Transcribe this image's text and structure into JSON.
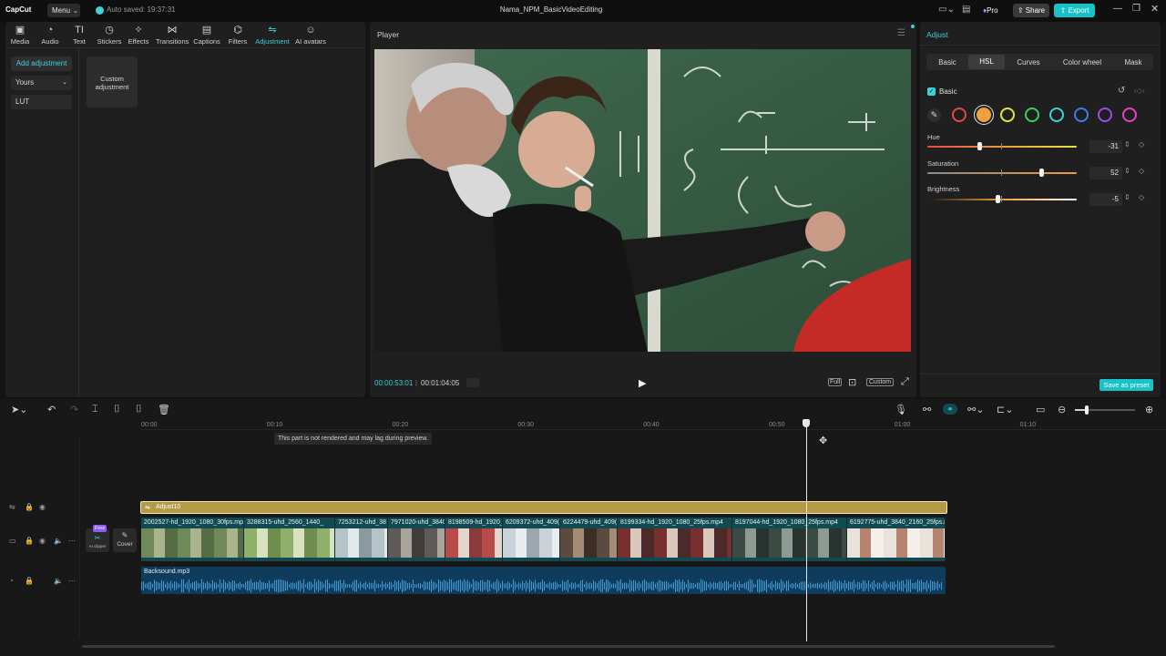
{
  "app": {
    "logo": "CapCut",
    "menu_label": "Menu",
    "autosave": "Auto saved: 19:37:31",
    "project_title": "Nama_NPM_BasicVideoEditing",
    "pro_label": "Pro",
    "share_label": "Share",
    "export_label": "Export"
  },
  "toolbar": {
    "items": [
      {
        "label": "Media",
        "icon": "media-icon"
      },
      {
        "label": "Audio",
        "icon": "audio-icon"
      },
      {
        "label": "Text",
        "icon": "text-icon"
      },
      {
        "label": "Stickers",
        "icon": "stickers-icon"
      },
      {
        "label": "Effects",
        "icon": "effects-icon"
      },
      {
        "label": "Transitions",
        "icon": "transitions-icon"
      },
      {
        "label": "Captions",
        "icon": "captions-icon"
      },
      {
        "label": "Filters",
        "icon": "filters-icon"
      },
      {
        "label": "Adjustment",
        "icon": "adjustment-icon",
        "active": true
      },
      {
        "label": "AI avatars",
        "icon": "ai-avatars-icon"
      }
    ]
  },
  "left": {
    "add_adjustment": "Add adjustment",
    "yours": "Yours",
    "lut": "LUT",
    "custom_card": "Custom adjustment"
  },
  "player": {
    "title": "Player",
    "current_time": "00:00:53:01",
    "total_time": "00:01:04:05",
    "full_label": "Full",
    "custom_label": "Custom"
  },
  "adjust": {
    "title": "Adjust",
    "tabs": [
      "Basic",
      "HSL",
      "Curves",
      "Color wheel",
      "Mask"
    ],
    "active_tab": "HSL",
    "section": "Basic",
    "swatch_colors": [
      "#e8444a",
      "#f0a040",
      "#e6e63a",
      "#3ccf5a",
      "#3fd0d8",
      "#3d7de8",
      "#9b4de6",
      "#e640c8"
    ],
    "hue": {
      "label": "Hue",
      "value": "-31",
      "fraction": 0.35
    },
    "saturation": {
      "label": "Saturation",
      "value": "52",
      "fraction": 0.76
    },
    "brightness": {
      "label": "Brightness",
      "value": "-5",
      "fraction": 0.47
    },
    "save_preset": "Save as preset"
  },
  "timeline": {
    "ruler": [
      "00:00",
      "00:10",
      "00:20",
      "00:30",
      "00:40",
      "00:50",
      "01:00",
      "01:10"
    ],
    "notice": "This part is not rendered and may lag during preview.",
    "adjust_clip": "Adjust10",
    "cover_label": "Cover",
    "free_badge": "Free",
    "ai_clipper": "AI clipper",
    "audio_clip": "Backsound.mp3",
    "clips": [
      "2002527-hd_1920_1080_30fps.mp4",
      "3288315-uhd_2560_1440_",
      "7253212-uhd_38",
      "7971020-uhd_3840",
      "8198509-hd_1920_",
      "6209372-uhd_409(",
      "6224479-uhd_409(",
      "8199334-hd_1920_1080_25fps.mp4",
      "8197044-hd_1920_1080_25fps.mp4",
      "6192775-uhd_3840_2160_25fps.m"
    ],
    "playhead_fraction": 0.8
  }
}
